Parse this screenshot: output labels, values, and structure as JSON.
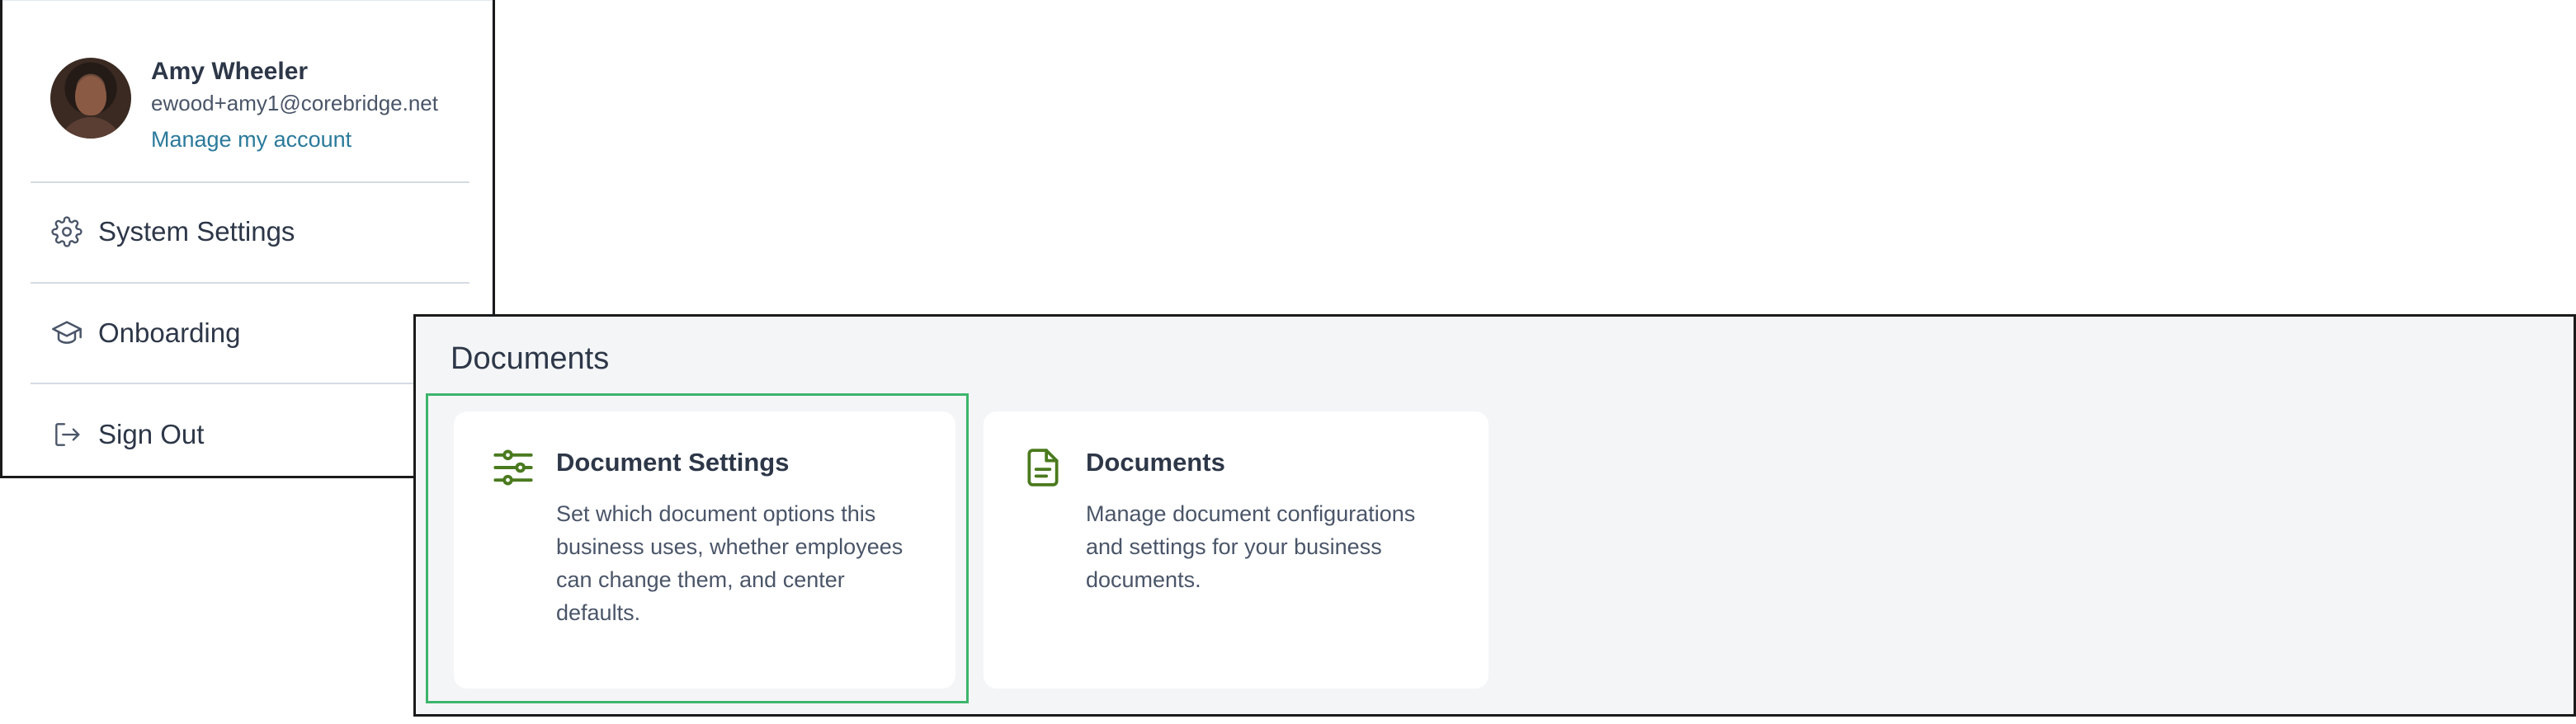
{
  "user_menu": {
    "name": "Amy Wheeler",
    "email": "ewood+amy1@corebridge.net",
    "manage_link": "Manage my account",
    "items": [
      {
        "label": "System Settings",
        "icon": "gear-icon"
      },
      {
        "label": "Onboarding",
        "icon": "graduation-cap-icon"
      },
      {
        "label": "Sign Out",
        "icon": "sign-out-icon"
      }
    ]
  },
  "documents": {
    "title": "Documents",
    "cards": [
      {
        "title": "Document Settings",
        "description": "Set which document options this business uses, whether employees can change them, and center defaults.",
        "icon": "sliders-icon"
      },
      {
        "title": "Documents",
        "description": "Manage document configurations and settings for your business documents.",
        "icon": "document-icon"
      }
    ]
  },
  "colors": {
    "accent_green": "#4a7a1e",
    "focus_green": "#3cb56a",
    "link_blue": "#2b7a9b",
    "section_bg": "#f4f5f7"
  }
}
